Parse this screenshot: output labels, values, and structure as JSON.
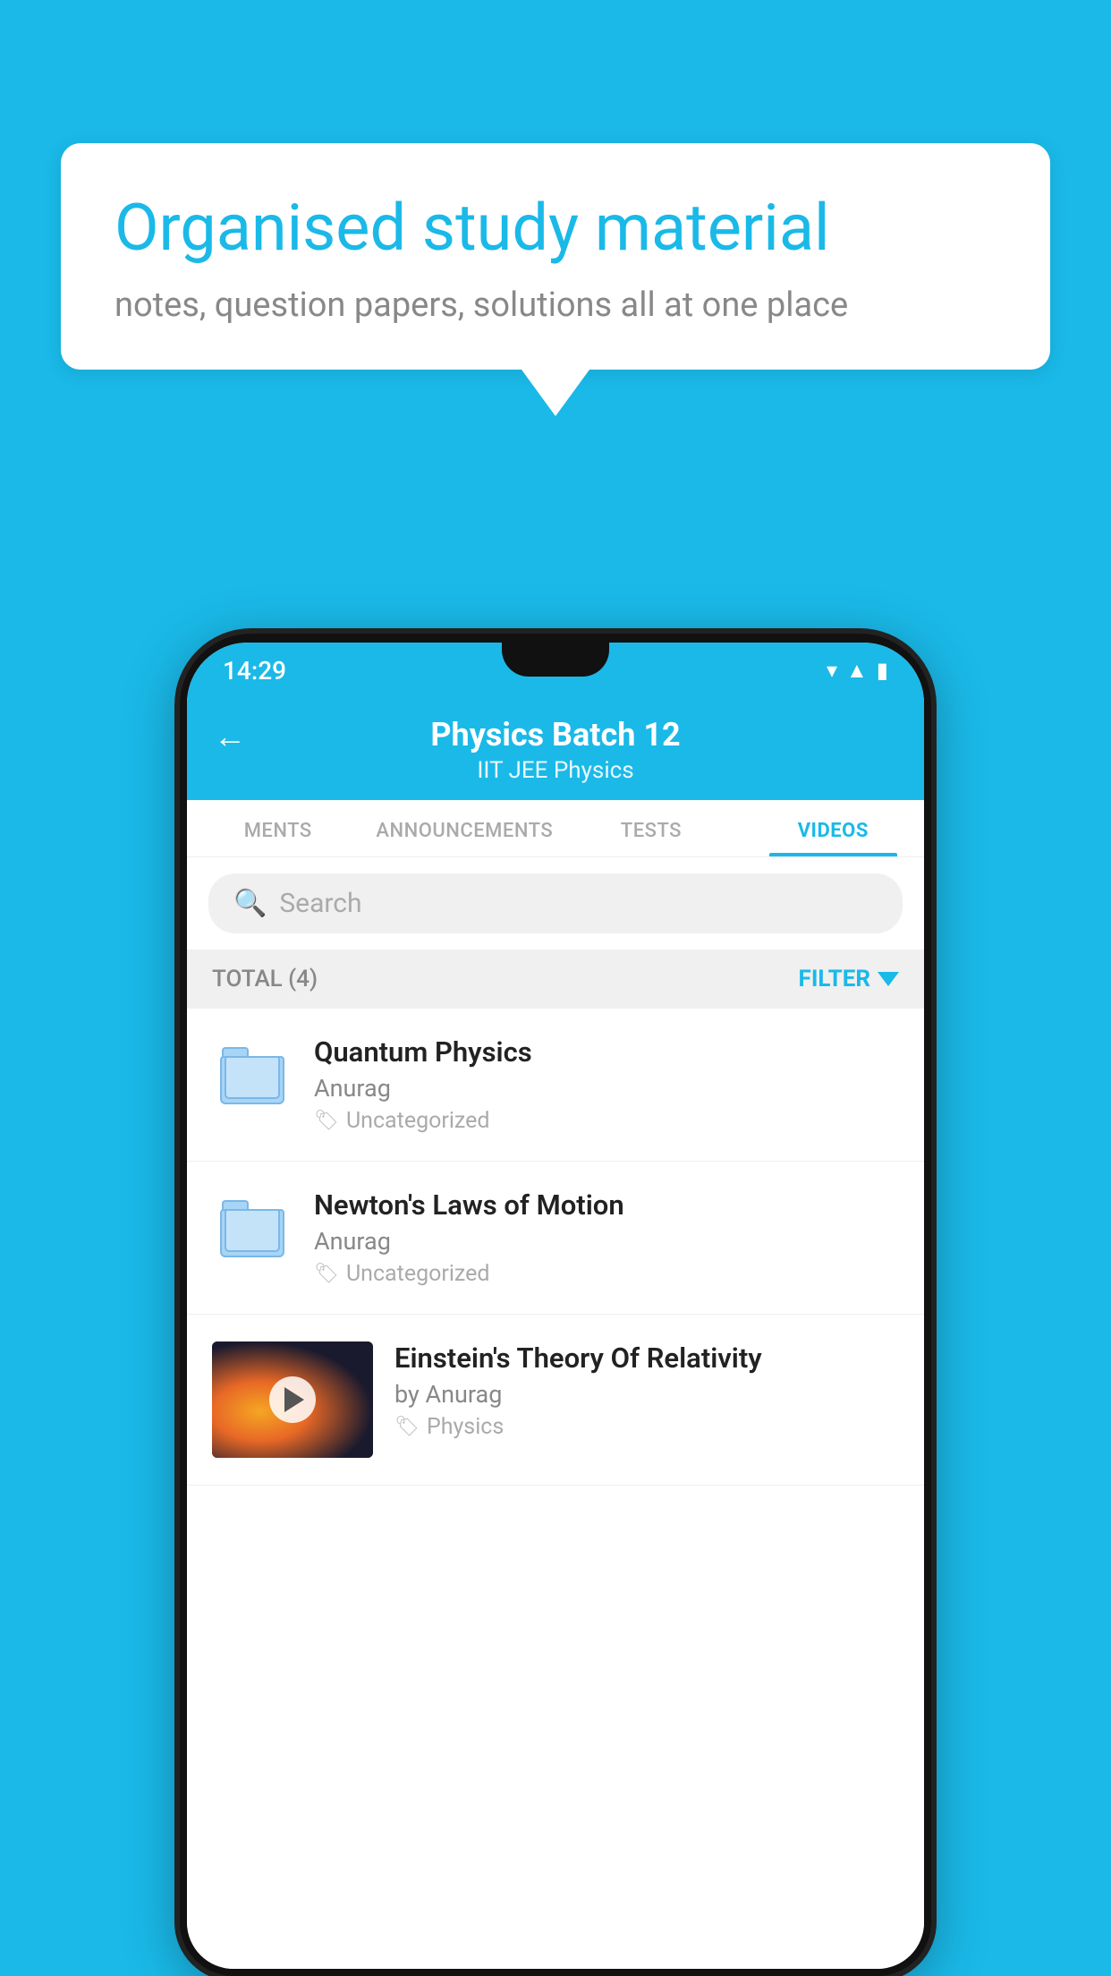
{
  "background": {
    "color": "#1ab9e8"
  },
  "speech_bubble": {
    "title": "Organised study material",
    "subtitle": "notes, question papers, solutions all at one place"
  },
  "phone": {
    "status_bar": {
      "time": "14:29",
      "icons": [
        "wifi",
        "signal",
        "battery"
      ]
    },
    "header": {
      "back_label": "←",
      "title": "Physics Batch 12",
      "subtitle": "IIT JEE   Physics"
    },
    "tabs": [
      {
        "label": "MENTS",
        "active": false
      },
      {
        "label": "ANNOUNCEMENTS",
        "active": false
      },
      {
        "label": "TESTS",
        "active": false
      },
      {
        "label": "VIDEOS",
        "active": true
      }
    ],
    "search": {
      "placeholder": "Search"
    },
    "filter_bar": {
      "total_label": "TOTAL (4)",
      "filter_label": "FILTER"
    },
    "videos": [
      {
        "title": "Quantum Physics",
        "author": "Anurag",
        "tag": "Uncategorized",
        "has_thumbnail": false
      },
      {
        "title": "Newton's Laws of Motion",
        "author": "Anurag",
        "tag": "Uncategorized",
        "has_thumbnail": false
      },
      {
        "title": "Einstein's Theory Of Relativity",
        "author": "by Anurag",
        "tag": "Physics",
        "has_thumbnail": true
      }
    ]
  }
}
